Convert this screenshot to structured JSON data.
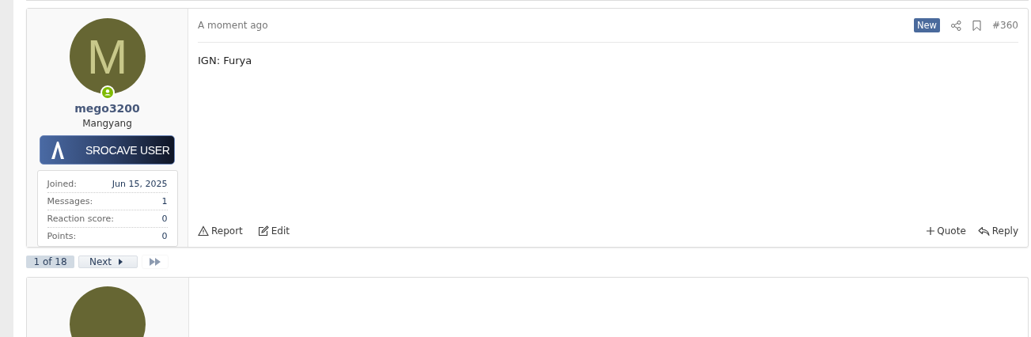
{
  "post": {
    "user": {
      "avatar_letter": "M",
      "online": true,
      "username": "mego3200",
      "title": "Mangyang",
      "banner": "SROCAVE USER",
      "stats": [
        {
          "label": "Joined:",
          "value": "Jun 15, 2025"
        },
        {
          "label": "Messages:",
          "value": "1"
        },
        {
          "label": "Reaction score:",
          "value": "0"
        },
        {
          "label": "Points:",
          "value": "0"
        }
      ]
    },
    "time": "A moment ago",
    "badge": "New",
    "number": "#360",
    "body": "IGN: Furya",
    "actions_left": [
      {
        "kind": "report",
        "label": "Report"
      },
      {
        "kind": "edit",
        "label": "Edit"
      }
    ],
    "actions_right": [
      {
        "kind": "quote",
        "label": "Quote"
      },
      {
        "kind": "reply",
        "label": "Reply"
      }
    ]
  },
  "pagination": {
    "current": "1 of 18",
    "next": "Next"
  }
}
